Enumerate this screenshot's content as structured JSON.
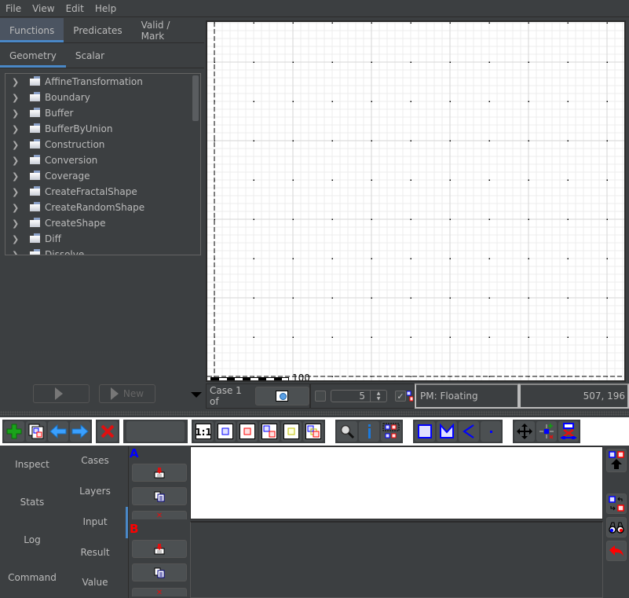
{
  "menu": [
    "File",
    "View",
    "Edit",
    "Help"
  ],
  "left_panel": {
    "tabs": [
      {
        "label": "Functions",
        "active": true
      },
      {
        "label": "Predicates",
        "active": false
      },
      {
        "label": "Valid / Mark",
        "active": false
      }
    ],
    "subtabs": [
      {
        "label": "Geometry",
        "active": true
      },
      {
        "label": "Scalar",
        "active": false
      }
    ],
    "tree_items": [
      "AffineTransformation",
      "Boundary",
      "Buffer",
      "BufferByUnion",
      "Construction",
      "Conversion",
      "Coverage",
      "CreateFractalShape",
      "CreateRandomShape",
      "CreateShape",
      "Diff",
      "Dissolve"
    ],
    "execute_button_label": "",
    "new_button_label": "New"
  },
  "canvas": {
    "scale_label": "100"
  },
  "status_bar": {
    "case_label": "Case 1 of",
    "spinner_value": "5",
    "checkbox_checked": true,
    "precision_model": "PM: Floating",
    "coordinates": "507, 196"
  },
  "toolbar": {
    "groups": [
      [
        "add-case",
        "copy-case",
        "previous-case",
        "next-case"
      ],
      [
        "delete-case"
      ],
      [
        "case-name-field"
      ],
      [
        "zoom-to-1-1",
        "zoom-to-a",
        "zoom-to-b",
        "zoom-to-ab",
        "zoom-to-result",
        "zoom-to-all"
      ],
      [
        "zoom-tool",
        "info-tool",
        "extract-component-tool"
      ],
      [
        "draw-rectangle",
        "draw-polygon",
        "draw-linestring",
        "draw-point"
      ],
      [
        "pan-tool",
        "edit-vertex-tool",
        "delete-vertex-tool"
      ]
    ]
  },
  "bottom_panel": {
    "left_tabs": [
      "Inspect",
      "Stats",
      "Log",
      "Command"
    ],
    "inner_tabs": [
      {
        "label": "Cases",
        "active": false
      },
      {
        "label": "Layers",
        "active": false
      },
      {
        "label": "Input",
        "active": true
      },
      {
        "label": "Result",
        "active": false
      },
      {
        "label": "Value",
        "active": false
      }
    ],
    "geometry_a_label": "A",
    "geometry_b_label": "B",
    "colors": {
      "a": "#0000ff",
      "b": "#ff0000",
      "accent": "#4a88c7"
    }
  }
}
